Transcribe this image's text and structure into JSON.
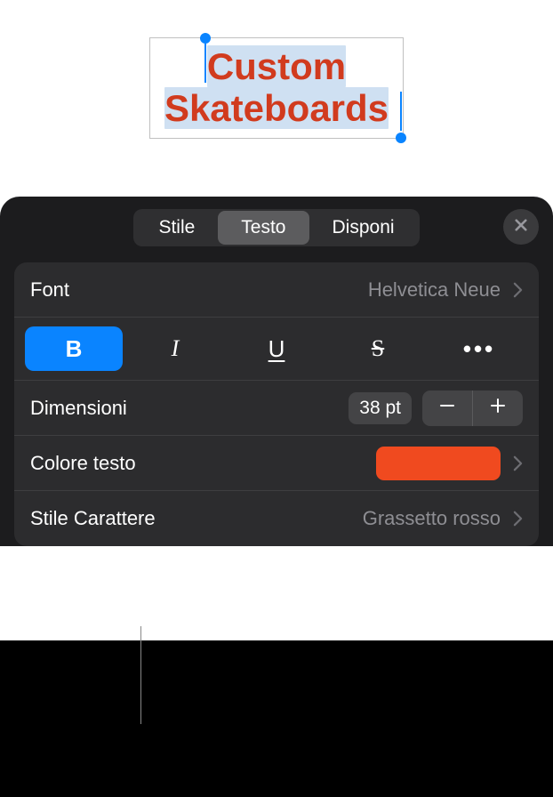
{
  "canvas": {
    "text_line1": "Custom",
    "text_line2": "Skateboards"
  },
  "panel": {
    "tabs": {
      "style": "Stile",
      "text": "Testo",
      "arrange": "Disponi"
    },
    "font": {
      "label": "Font",
      "value": "Helvetica Neue"
    },
    "format_buttons": {
      "bold": "B",
      "italic": "I",
      "underline": "U",
      "strike": "S",
      "more": "•••"
    },
    "size": {
      "label": "Dimensioni",
      "value": "38 pt"
    },
    "text_color": {
      "label": "Colore testo",
      "swatch": "#f04a1f"
    },
    "char_style": {
      "label": "Stile Carattere",
      "value": "Grassetto rosso"
    }
  }
}
